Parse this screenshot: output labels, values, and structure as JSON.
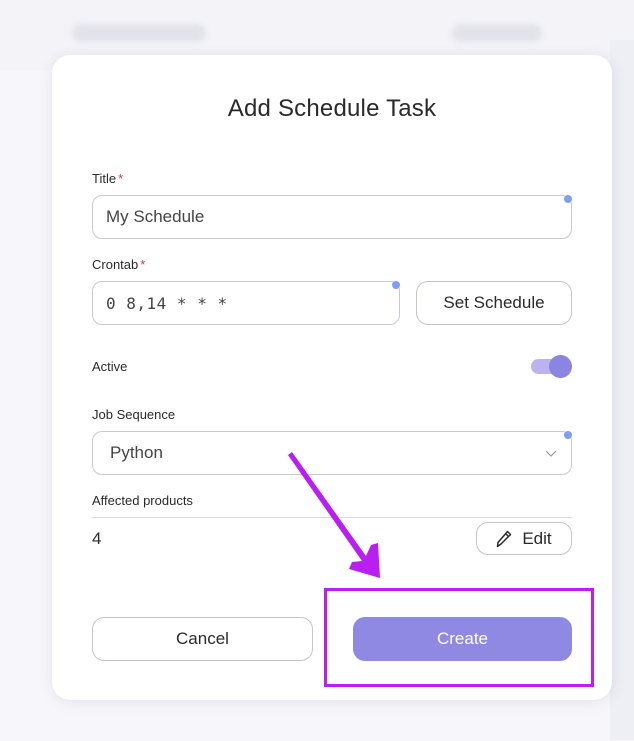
{
  "modal": {
    "title": "Add Schedule Task",
    "title_field": {
      "label": "Title",
      "required_mark": "*",
      "value": "My Schedule"
    },
    "crontab_field": {
      "label": "Crontab",
      "required_mark": "*",
      "value": "0 8,14 * * *"
    },
    "set_schedule_label": "Set Schedule",
    "active": {
      "label": "Active",
      "enabled": true
    },
    "job_sequence": {
      "label": "Job Sequence",
      "selected": "Python"
    },
    "affected_products": {
      "label": "Affected products",
      "count": "4",
      "edit_label": "Edit"
    },
    "cancel_label": "Cancel",
    "create_label": "Create"
  },
  "colors": {
    "accent": "#8f89e3",
    "toggle_track": "#b9b3ee",
    "required": "#e0323c",
    "annotation": "#b81ff0",
    "focus_dot": "#7fa0f0"
  },
  "icons": {
    "edit": "pencil-icon",
    "select": "chevron-down-icon"
  }
}
